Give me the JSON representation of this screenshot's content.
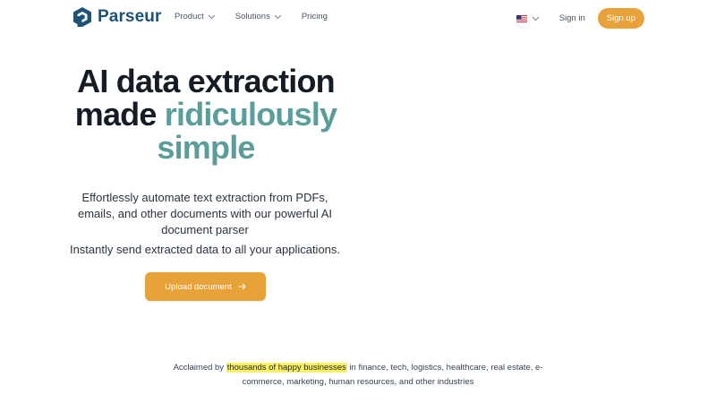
{
  "brand": {
    "name": "Parseur",
    "logo_icon": "parseur-hexagon-logo",
    "color": "#1e5276"
  },
  "nav": {
    "items": [
      {
        "label": "Product",
        "has_dropdown": true
      },
      {
        "label": "Solutions",
        "has_dropdown": true
      },
      {
        "label": "Pricing",
        "has_dropdown": false
      }
    ]
  },
  "header": {
    "language_icon": "us-flag-icon",
    "sign_in": "Sign in",
    "sign_up": "Sign up"
  },
  "hero": {
    "title_line1": "AI data extraction",
    "title_line2_plain": "made",
    "title_line2_accent": "ridiculously",
    "title_line3_accent": "simple",
    "description": "Effortlessly automate text extraction from PDFs, emails, and other documents with our powerful AI document parser",
    "subtext": "Instantly send extracted data to all your applications.",
    "cta": "Upload document",
    "cta_icon": "arrow-right-icon"
  },
  "acclaim": {
    "prefix": "Acclaimed by",
    "highlight": "thousands of happy businesses",
    "suffix": "in finance, tech, logistics, healthcare, real estate, e-commerce, marketing, human resources, and other industries"
  },
  "colors": {
    "accent": "#e8a23a",
    "teal": "#5a9d9b",
    "highlight": "#f8ef63",
    "text": "#161c25"
  }
}
